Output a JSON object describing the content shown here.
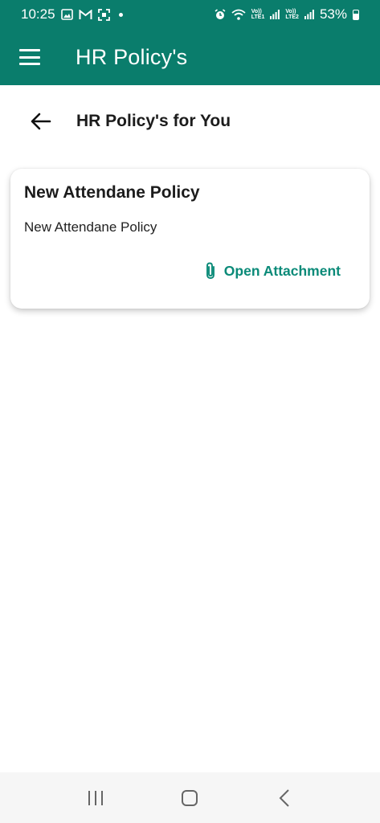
{
  "status_bar": {
    "time": "10:25",
    "network_labels": [
      "Vo))",
      "LTE1",
      "Vo))",
      "LTE2"
    ],
    "battery": "53%",
    "icons": [
      "gallery-icon",
      "gmail-icon",
      "scan-icon",
      "alarm-icon",
      "wifi-icon",
      "signal-icon"
    ]
  },
  "app_bar": {
    "title": "HR Policy's",
    "menu_icon": "hamburger-menu-icon"
  },
  "subheader": {
    "title": "HR Policy's for You",
    "back_icon": "back-arrow-icon"
  },
  "policies": [
    {
      "title": "New Attendane Policy",
      "description": "New Attendane Policy",
      "action_label": "Open Attachment",
      "action_icon": "paperclip-icon"
    }
  ],
  "nav_bar": {
    "buttons": [
      "recent-apps",
      "home",
      "back"
    ]
  },
  "colors": {
    "primary": "#0a7d6c",
    "accent": "#0a8a78",
    "text": "#1c1c1c",
    "nav_bg": "#f6f6f6"
  }
}
